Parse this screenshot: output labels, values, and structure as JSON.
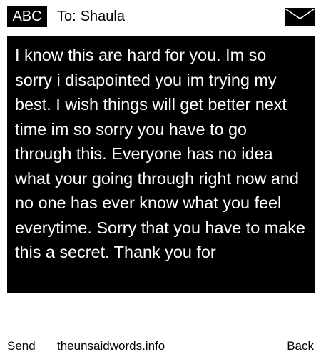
{
  "header": {
    "badge": "ABC",
    "to_label": "To:",
    "recipient": "Shaula"
  },
  "message": {
    "body": "I know this are hard for you. Im so sorry i disapointed you im trying my best. I wish things will get better next time im so sorry you have to go through this. Everyone has no idea what your going through right now and no one has ever know what you feel everytime. Sorry that you have to make this a secret. Thank you for"
  },
  "footer": {
    "send_label": "Send",
    "site": "theunsaidwords.info",
    "back_label": "Back"
  },
  "icons": {
    "envelope": "envelope-icon"
  }
}
